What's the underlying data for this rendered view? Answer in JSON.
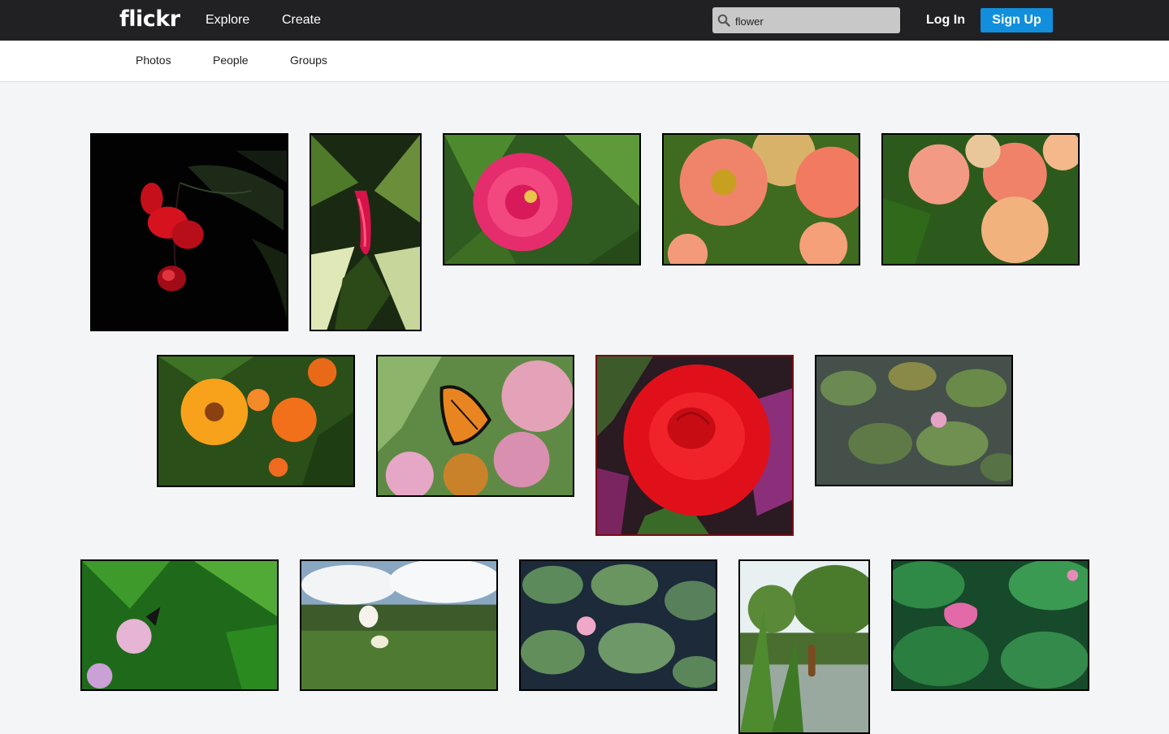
{
  "header": {
    "logo": "flickr",
    "nav": [
      "Explore",
      "Create"
    ],
    "search": {
      "value": "flower",
      "placeholder": ""
    },
    "login_label": "Log In",
    "signup_label": "Sign Up"
  },
  "subnav": {
    "items": [
      "Photos",
      "People",
      "Groups"
    ]
  },
  "colors": {
    "header_bg": "#212124",
    "accent": "#128fdc",
    "page_bg": "#f3f5f6"
  },
  "photos": [
    "red-hibiscus",
    "red-ginger",
    "pink-zinnia",
    "salmon-zinnias",
    "zinnia-bed",
    "orange-zinnias",
    "monarch-butterfly",
    "red-rose",
    "water-lily-pond",
    "milkweed-butterfly",
    "lotus-field",
    "water-lilies",
    "cattails",
    "pink-lotus"
  ]
}
